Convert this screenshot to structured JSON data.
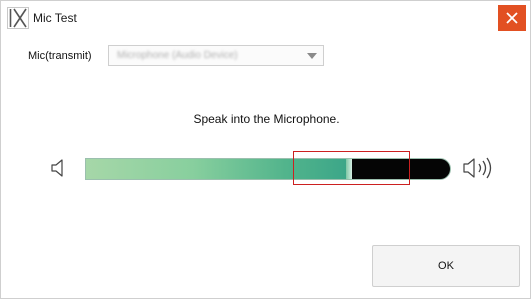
{
  "window": {
    "title": "Mic Test",
    "close_color": "#e25022"
  },
  "form": {
    "mic_label": "Mic(transmit)",
    "mic_selected": "Microphone (Audio Device)"
  },
  "meter": {
    "instruction": "Speak into the Microphone.",
    "level_fraction": 0.73,
    "fill_colors": [
      "#a6d7a8",
      "#3aa588"
    ],
    "highlight_color": "#cc2020"
  },
  "buttons": {
    "ok_label": "OK"
  },
  "icons": {
    "app": "ix-logo-icon",
    "close": "close-icon",
    "speaker_low": "speaker-low-icon",
    "speaker_high": "speaker-high-icon",
    "dropdown": "chevron-down-icon"
  }
}
